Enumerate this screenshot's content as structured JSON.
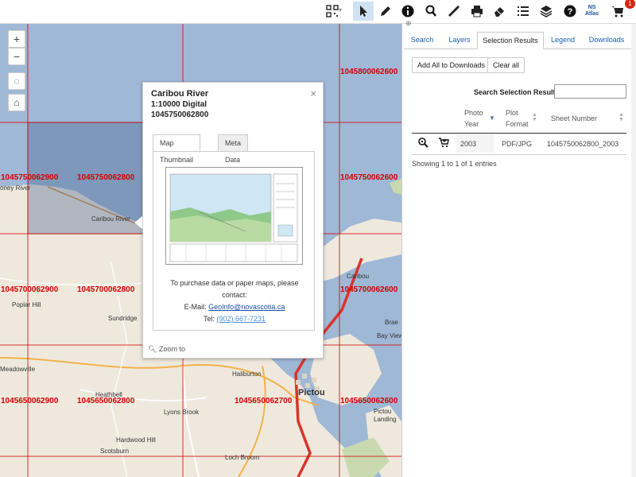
{
  "toolbar": {
    "items": [
      {
        "icon": "qr-code-icon"
      },
      {
        "icon": "pointer-icon",
        "active": true
      },
      {
        "icon": "pencil-icon"
      },
      {
        "icon": "info-icon"
      },
      {
        "icon": "magnifier-icon"
      },
      {
        "icon": "ruler-icon"
      },
      {
        "icon": "print-icon"
      },
      {
        "icon": "eraser-icon"
      },
      {
        "icon": "list-icon"
      },
      {
        "icon": "layers-icon"
      },
      {
        "icon": "help-icon"
      },
      {
        "icon": "ns-atlas-icon"
      },
      {
        "icon": "cart-icon"
      }
    ],
    "ns_atlas_line1": "NS",
    "ns_atlas_line2": "Atlas",
    "cart_count": "1",
    "accent": "#cfe2f3"
  },
  "map": {
    "controls": {
      "zoom_in": "+",
      "zoom_out": "−",
      "locate": "◌",
      "home": "⌂"
    },
    "grid_labels": [
      "1045800062600",
      "1045750062900",
      "1045750062800",
      "1045750062600",
      "1045700062900",
      "1045700062800",
      "1045700062600",
      "1045650062900",
      "1045650062800",
      "1045650062700",
      "1045650062600"
    ],
    "places": [
      "oney River",
      "Caribou River",
      "Poplar Hill",
      "Sundridge",
      "Caribou",
      "Brae",
      "Bay View",
      "Meadowville",
      "Haliburton",
      "Heathbell",
      "Pictou",
      "Lyons Brook",
      "Pictou Landing",
      "Hardwood Hill",
      "Scotsburn",
      "Loch Broom"
    ],
    "grid_color": "#d40000",
    "water_color": "#9fb8d6"
  },
  "popup": {
    "title": "Caribou River",
    "scale": "1:10000 Digital",
    "sheet": "1045750062800",
    "tabs": [
      "Map Thumbnail",
      "Meta Data"
    ],
    "purchase_text": "To purchase data or paper maps, please contact:",
    "email_label": "E-Mail:",
    "email": "GeoInfo@novascotia.ca",
    "tel_label": "Tel:",
    "tel": "(902) 667-7231",
    "zoom_to": "Zoom to",
    "close": "×"
  },
  "panel": {
    "tabs": [
      "Search",
      "Layers",
      "Selection Results",
      "Legend",
      "Downloads"
    ],
    "active_tab": "Selection Results",
    "add_all_button": "Add All to Downloads",
    "clear_all_button": "Clear all",
    "search_label": "Search Selection Results:",
    "search_value": "",
    "columns": [
      {
        "line1": "Photo",
        "line2": "Year"
      },
      {
        "line1": "Plot",
        "line2": "Format"
      },
      {
        "line1": "Sheet Number",
        "line2": ""
      }
    ],
    "rows": [
      {
        "year": "2003",
        "format": "PDF/JPG",
        "sheet": "1045750062800_2003"
      }
    ],
    "entries_text": "Showing 1 to 1 of 1 entries"
  }
}
